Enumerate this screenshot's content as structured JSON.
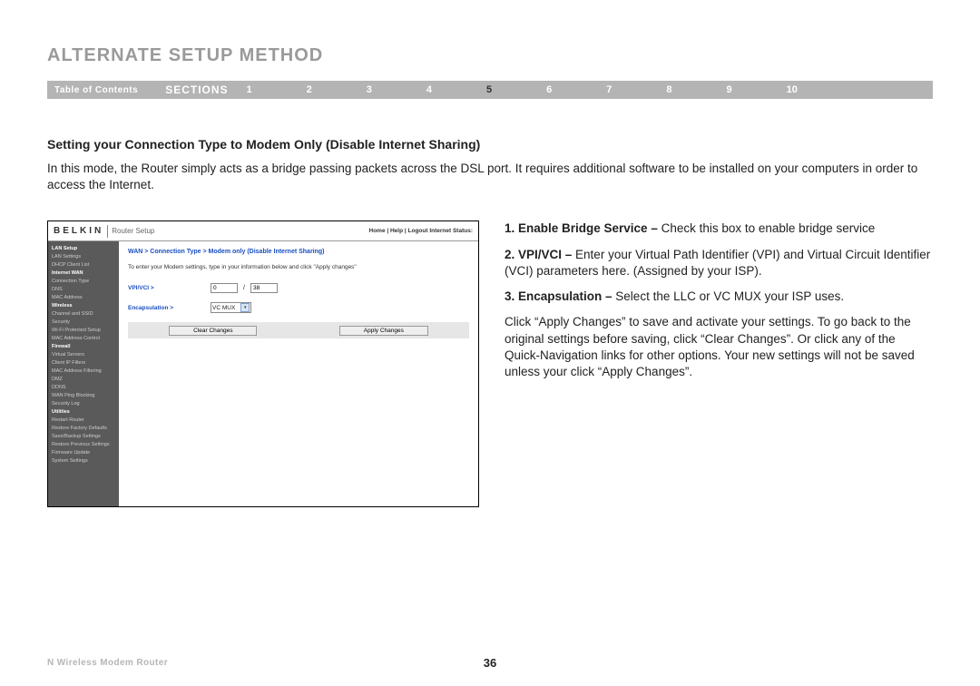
{
  "page_title": "ALTERNATE SETUP METHOD",
  "navbar": {
    "toc": "Table of Contents",
    "sections_label": "SECTIONS",
    "numbers": [
      "1",
      "2",
      "3",
      "4",
      "5",
      "6",
      "7",
      "8",
      "9",
      "10"
    ],
    "active_index": 4
  },
  "setting_heading": "Setting your Connection Type to Modem Only (Disable Internet Sharing)",
  "intro": "In this mode, the Router simply acts as a bridge passing packets across the DSL port. It requires additional software to be installed on your computers in order to access the Internet.",
  "screenshot": {
    "brand": "BELKIN",
    "header_sub": "Router Setup",
    "header_right": "Home | Help | Logout   Internet Status:",
    "sidebar": [
      {
        "t": "LAN Setup",
        "h": true
      },
      {
        "t": "LAN Settings",
        "h": false
      },
      {
        "t": "DHCP Client List",
        "h": false
      },
      {
        "t": "Internet WAN",
        "h": true
      },
      {
        "t": "Connection Type",
        "h": false
      },
      {
        "t": "DNS",
        "h": false
      },
      {
        "t": "MAC Address",
        "h": false
      },
      {
        "t": "Wireless",
        "h": true
      },
      {
        "t": "Channel and SSID",
        "h": false
      },
      {
        "t": "Security",
        "h": false
      },
      {
        "t": "Wi-Fi Protected Setup",
        "h": false
      },
      {
        "t": "MAC Address Control",
        "h": false
      },
      {
        "t": "Firewall",
        "h": true
      },
      {
        "t": "Virtual Servers",
        "h": false
      },
      {
        "t": "Client IP Filters",
        "h": false
      },
      {
        "t": "MAC Address Filtering",
        "h": false
      },
      {
        "t": "DMZ",
        "h": false
      },
      {
        "t": "DDNS",
        "h": false
      },
      {
        "t": "WAN Ping Blocking",
        "h": false
      },
      {
        "t": "Security Log",
        "h": false
      },
      {
        "t": "Utilities",
        "h": true
      },
      {
        "t": "Restart Router",
        "h": false
      },
      {
        "t": "Restore Factory Defaults",
        "h": false
      },
      {
        "t": "Save/Backup Settings",
        "h": false
      },
      {
        "t": "Restore Previous Settings",
        "h": false
      },
      {
        "t": "Firmware Update",
        "h": false
      },
      {
        "t": "System Settings",
        "h": false
      }
    ],
    "breadcrumb": "WAN > Connection Type > Modem only (Disable Internet Sharing)",
    "helptext": "To enter your Modem settings, type in your information below and click \"Apply changes\"",
    "vpivci_label": "VPI/VCI >",
    "vpi_value": "0",
    "vci_value": "38",
    "encaps_label": "Encapsulation >",
    "encaps_value": "VC MUX",
    "btn_clear": "Clear Changes",
    "btn_apply": "Apply Changes"
  },
  "instructions": {
    "i1_bold": "1. Enable Bridge Service – ",
    "i1_rest": "Check this box to enable bridge service",
    "i2_bold": "2. VPI/VCI – ",
    "i2_rest": "Enter your Virtual Path Identifier (VPI) and Virtual Circuit Identifier (VCI) parameters here. (Assigned by your ISP).",
    "i3_bold": "3. Encapsulation – ",
    "i3_rest": "Select the LLC or VC MUX your ISP uses.",
    "closing": "Click “Apply Changes” to save and activate your settings. To go back to the original settings before saving, click “Clear Changes”. Or click any of the Quick-Navigation links for other options. Your new settings will not be saved unless your click “Apply Changes”."
  },
  "footer": {
    "product": "N Wireless Modem Router",
    "page_number": "36"
  }
}
